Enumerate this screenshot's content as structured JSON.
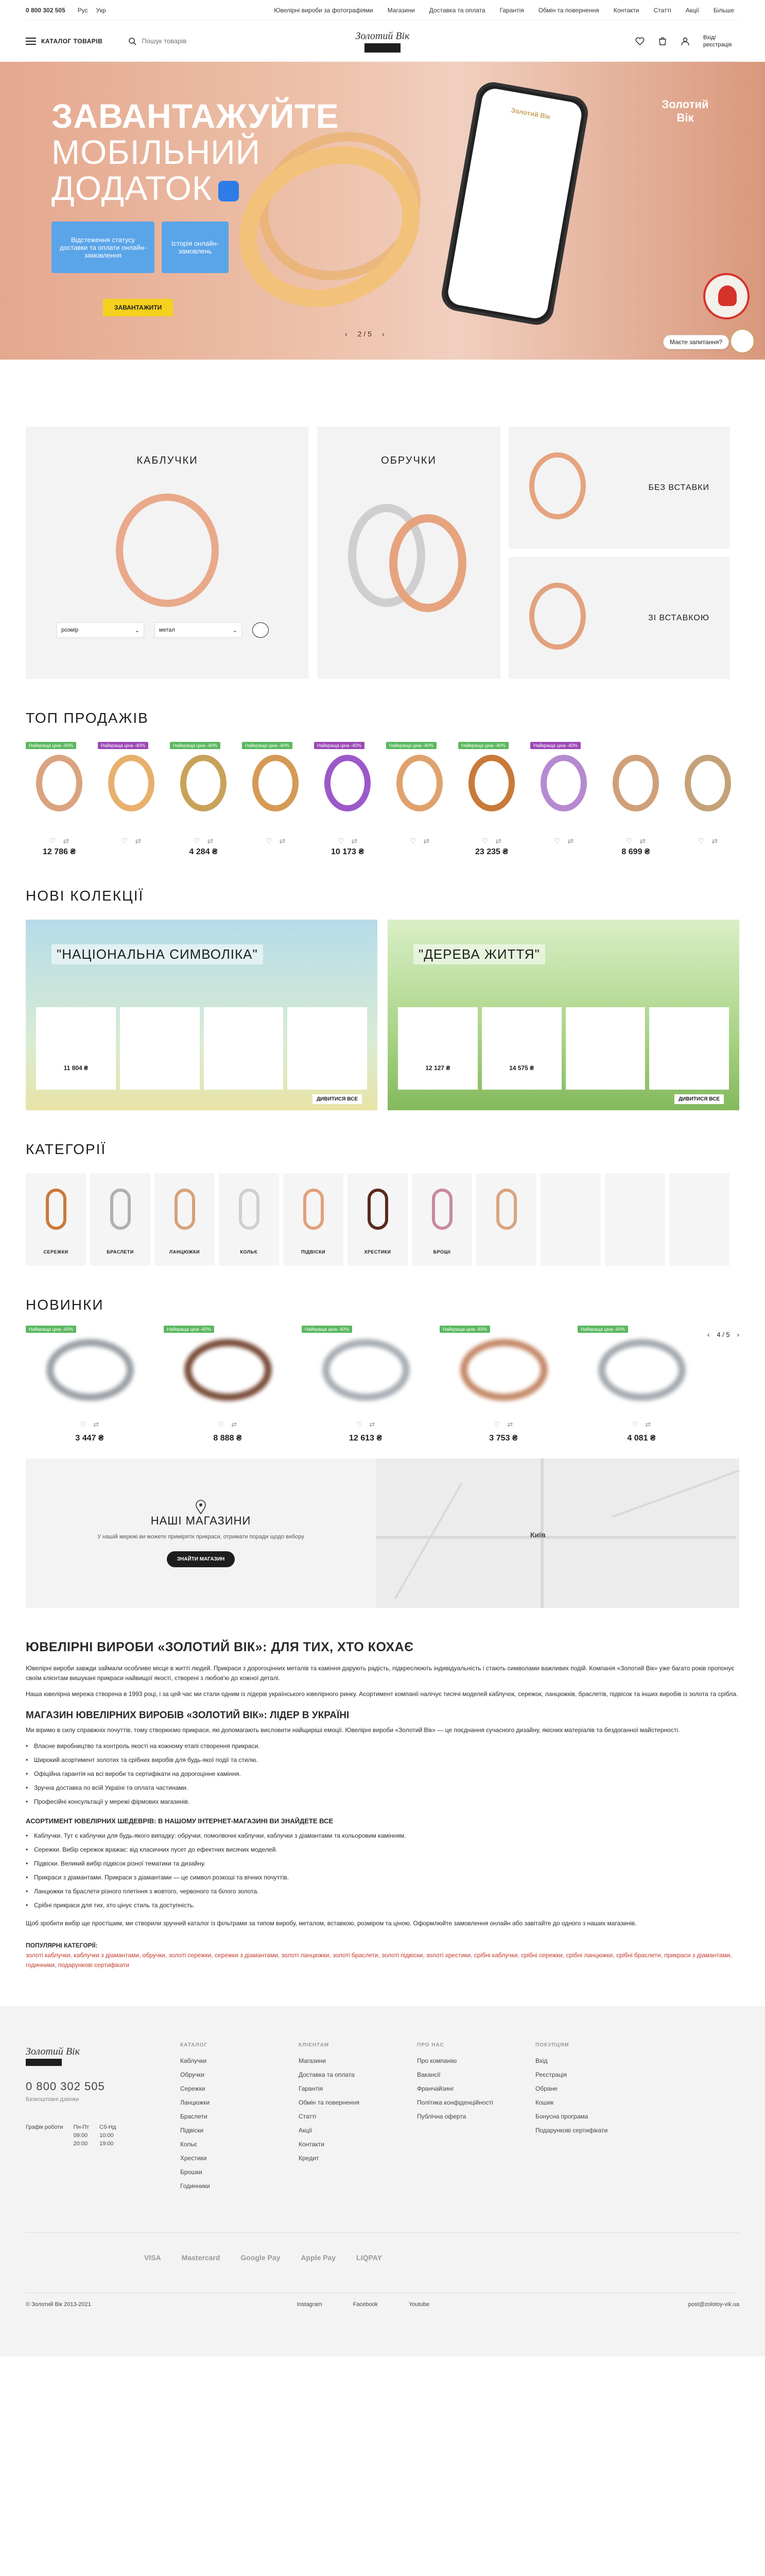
{
  "topbar": {
    "phone": "0 800 302 505",
    "lang_ru": "Рус",
    "lang_ua": "Укр",
    "nav": [
      "Ювелірні вироби за фотографіями",
      "Магазини",
      "Доставка та оплата",
      "Гарантія",
      "Обмін та повернення",
      "Контакти",
      "Статті",
      "Акції"
    ],
    "more": "Більше"
  },
  "header": {
    "catalog": "КАТАЛОГ ТОВАРІВ",
    "search_placeholder": "Пошук товарів",
    "logo": "Золотий Вік",
    "login": "Вхід/\nреєстрація"
  },
  "hero": {
    "title_bold": "ЗАВАНТАЖУЙТЕ",
    "title_line2": "МОБІЛЬНИЙ",
    "title_line3": "ДОДАТОК",
    "card1": "Відстеження статусу доставки та оплати онлайн-замовлення",
    "card2": "Історія онлайн-замовлень",
    "button": "ЗАВАНТАЖИТИ",
    "slide": "2 / 5",
    "logo": "Золотий Вік",
    "phone_logo": "Золотий Вік"
  },
  "chat": {
    "bubble": "Маєте запитання?"
  },
  "tiles": {
    "earrings": "КАБЛУЧКИ",
    "earrings_select1": "розмір",
    "earrings_select2": "метал",
    "rings": "ОБРУЧКИ",
    "no_stones": "БЕЗ ВСТАВКИ",
    "with_stones": "ЗІ ВСТАВКОЮ"
  },
  "top_sales": {
    "title": "ТОП ПРОДАЖІВ",
    "products": [
      {
        "badge": "Найкраща ціна -40%",
        "old": "",
        "price": "12 786 ₴"
      },
      {
        "badge": "Найкраща ціна -40%",
        "old": "",
        "price": ""
      },
      {
        "badge": "Найкраща ціна -40%",
        "old": "",
        "price": "4 284 ₴"
      },
      {
        "badge": "Найкраща ціна -40%",
        "old": "",
        "price": ""
      },
      {
        "badge": "Найкраща ціна -40%",
        "old": "",
        "price": "10 173 ₴"
      },
      {
        "badge": "Найкраща ціна -40%",
        "old": "",
        "price": ""
      },
      {
        "badge": "Найкраща ціна -40%",
        "old": "",
        "price": "23 235 ₴"
      },
      {
        "badge": "Найкраща ціна -40%",
        "old": "",
        "price": ""
      },
      {
        "badge": "",
        "old": "",
        "price": "8 699 ₴"
      },
      {
        "badge": "",
        "old": "",
        "price": ""
      }
    ]
  },
  "collections": {
    "title": "НОВІ КОЛЕКЦІЇ",
    "items": [
      {
        "title": "\"НАЦІОНАЛЬНА СИМВОЛІКА\"",
        "prices": [
          "11 804 ₴",
          "",
          "",
          ""
        ],
        "link": "ДИВИТИСЯ ВСЕ"
      },
      {
        "title": "\"ДЕРЕВА ЖИТТЯ\"",
        "prices": [
          "12 127 ₴",
          "14 575 ₴",
          "",
          ""
        ],
        "link": "ДИВИТИСЯ ВСЕ"
      }
    ]
  },
  "categories": {
    "title": "КАТЕГОРІЇ",
    "items": [
      "СЕРЕЖКИ",
      "БРАСЛЕТИ",
      "ЛАНЦЮЖКИ",
      "КОЛЬЄ",
      "ПІДВІСКИ",
      "ХРЕСТИКИ",
      "БРОШІ",
      ""
    ]
  },
  "novelties": {
    "title": "НОВИНКИ",
    "pager": "4 / 5",
    "products": [
      {
        "badge": "Найкраща ціна -40%",
        "old": "",
        "price": "3 447 ₴"
      },
      {
        "badge": "Найкраща ціна -40%",
        "old": "",
        "price": "8 888 ₴"
      },
      {
        "badge": "Найкраща ціна -40%",
        "old": "",
        "price": "12 613 ₴"
      },
      {
        "badge": "Найкраща ціна -40%",
        "old": "",
        "price": "3 753 ₴"
      },
      {
        "badge": "Найкраща ціна -40%",
        "old": "",
        "price": "4 081 ₴"
      }
    ]
  },
  "stores": {
    "title": "НАШІ МАГАЗИНИ",
    "text": "У нашій мережі ви можете приміряти прикраси, отримати поради щодо вибору",
    "button": "ЗНАЙТИ МАГАЗИН",
    "city": "Київ"
  },
  "seo": {
    "h1": "ЮВЕЛІРНІ ВИРОБИ «ЗОЛОТИЙ ВІК»: ДЛЯ ТИХ, ХТО КОХАЄ",
    "p1": "Ювелірні вироби завжди займали особливе місце в житті людей. Прикраси з дорогоцінних металів та каміння дарують радість, підкреслюють індивідуальність і стають символами важливих подій. Компанія «Золотий Вік» уже багато років пропонує своїм клієнтам вишукані прикраси найвищої якості, створені з любов'ю до кожної деталі.",
    "p2": "Наша ювелірна мережа створена в 1993 році, і за цей час ми стали одним із лідерів українського ювелірного ринку. Асортимент компанії налічує тисячі моделей каблучок, сережок, ланцюжків, браслетів, підвісок та інших виробів із золота та срібла.",
    "h2": "МАГАЗИН ЮВЕЛІРНИХ ВИРОБІВ «ЗОЛОТИЙ ВІК»: ЛІДЕР В УКРАЇНІ",
    "p3": "Ми віримо в силу справжніх почуттів, тому створюємо прикраси, які допомагають висловити найщиріші емоції. Ювелірні вироби «Золотий Вік» — це поєднання сучасного дизайну, якісних матеріалів та бездоганної майстерності.",
    "bullets": [
      "Власне виробництво та контроль якості на кожному етапі створення прикраси.",
      "Широкий асортимент золотих та срібних виробів для будь-якої події та стилю.",
      "Офіційна гарантія на всі вироби та сертифікати на дорогоцінне каміння.",
      "Зручна доставка по всій Україні та оплата частинами.",
      "Професійні консультації у мережі фірмових магазинів."
    ],
    "sub": "АСОРТИМЕНТ ЮВЕЛІРНИХ ШЕДЕВРІВ: В НАШОМУ ІНТЕРНЕТ-МАГАЗИНІ ВИ ЗНАЙДЕТЕ ВСЕ",
    "bullets2": [
      "Каблучки. Тут є каблучки для будь-якого випадку: обручки, помолвочні каблучки, каблучки з діамантами та кольоровим камінням.",
      "Сережки. Вибір сережок вражає: від класичних пусет до ефектних висячих моделей.",
      "Підвіски. Великий вибір підвісок різної тематики та дизайну.",
      "Прикраси з діамантами. Прикраси з діамантами — це символ розкоші та вічних почуттів.",
      "Ланцюжки та браслети різного плетіння з жовтого, червоного та білого золота.",
      "Срібні прикраси для тих, хто цінує стиль та доступність."
    ],
    "p4": "Щоб зробити вибір ще простішим, ми створили зручний каталог із фільтрами за типом виробу, металом, вставкою, розміром та ціною. Оформлюйте замовлення онлайн або завітайте до одного з наших магазинів.",
    "pop_title": "ПОПУЛЯРНІ КАТЕГОРІЇ:",
    "pop_links": "золоті каблучки, каблучки з діамантами, обручки, золоті сережки, сережки з діамантами, золоті ланцюжки, золоті браслети, золоті підвіски, золоті хрестики, срібні каблучки, срібні сережки, срібні ланцюжки, срібні браслети, прикраси з діамантами, годинники, подарункові сертифікати"
  },
  "footer": {
    "logo": "Золотий Вік",
    "phone": "0 800 302 505",
    "phone_note": "Безкоштовні дзвінки",
    "hours_label": "Графік роботи",
    "hours1": "Пн-Пт\n09:00\n20:00",
    "hours2": "Сб-Нд\n10:00\n19:00",
    "cols": [
      {
        "title": "КАТАЛОГ",
        "items": [
          "Каблучки",
          "Обручки",
          "Сережки",
          "Ланцюжки",
          "Браслети",
          "Підвіски",
          "Кольє",
          "Хрестики",
          "Брошки",
          "Годинники"
        ]
      },
      {
        "title": "КЛІЄНТАМ",
        "items": [
          "Магазини",
          "Доставка та оплата",
          "Гарантія",
          "Обмін та повернення",
          "Статті",
          "Акції",
          "Контакти",
          "Кредит"
        ]
      },
      {
        "title": "ПРО НАС",
        "items": [
          "Про компанію",
          "Вакансії",
          "Франчайзинг",
          "Політика конфіденційності",
          "Публічна оферта"
        ]
      },
      {
        "title": "ПОКУПЦЯМ",
        "items": [
          "Вхід",
          "Реєстрація",
          "Обране",
          "Кошик",
          "Бонусна програма",
          "Подарункові сертифікати"
        ]
      }
    ],
    "pays": [
      "VISA",
      "Mastercard",
      "Google Pay",
      "Apple Pay",
      "LIQPAY"
    ],
    "copyright": "© Золотий Вік 2013-2021",
    "social": [
      "Instagram",
      "Facebook",
      "Youtube"
    ],
    "email": "post@zolotoy-vik.ua"
  }
}
